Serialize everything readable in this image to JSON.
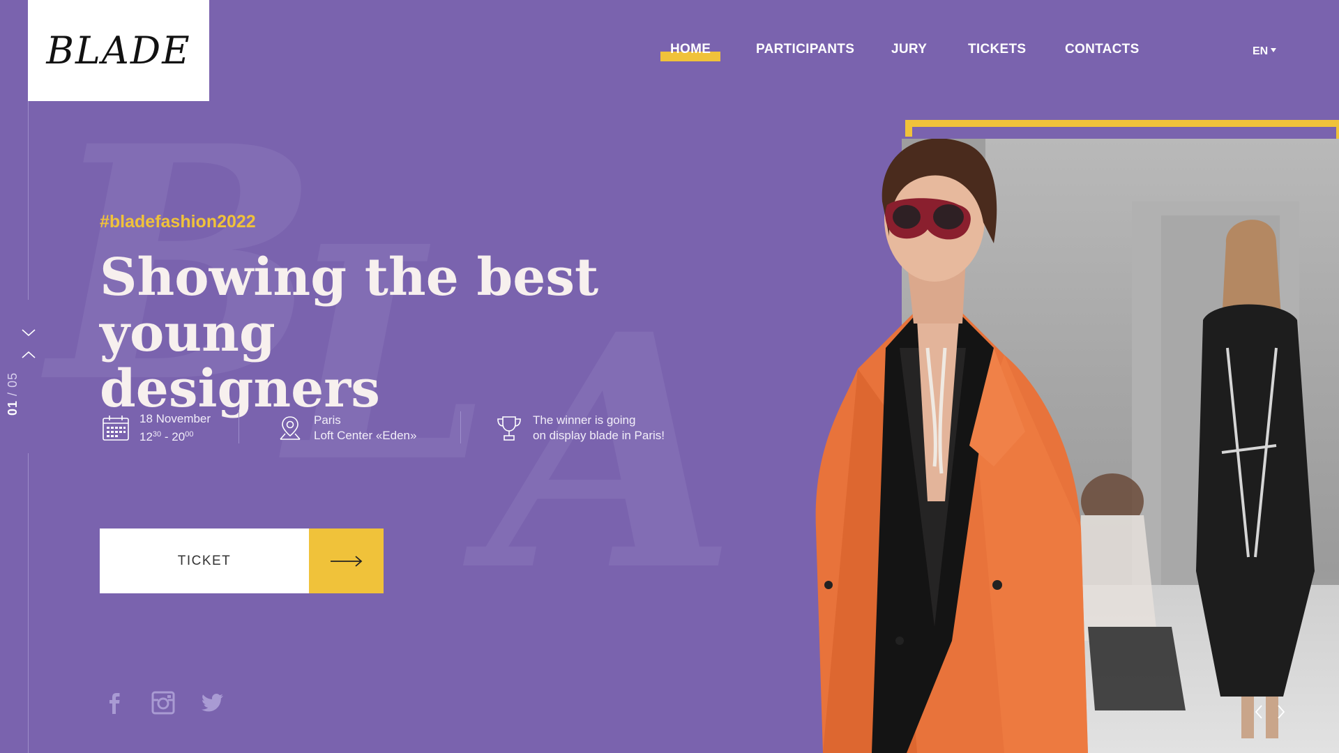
{
  "brand": {
    "logo_text": "BLADE"
  },
  "nav": {
    "items": [
      {
        "label": "HOME",
        "active": true
      },
      {
        "label": "PARTICIPANTS",
        "active": false
      },
      {
        "label": "JURY",
        "active": false
      },
      {
        "label": "TICKETS",
        "active": false
      },
      {
        "label": "CONTACTS",
        "active": false
      }
    ],
    "language": "EN"
  },
  "slider": {
    "current": "01",
    "separator": "/",
    "total": "05"
  },
  "hero": {
    "hashtag": "#bladefashion2022",
    "headline_line1": "Showing the best young",
    "headline_line2": "designers"
  },
  "info": {
    "date": {
      "day": "18 November",
      "start_hour": "12",
      "start_min": "30",
      "dash": " - ",
      "end_hour": "20",
      "end_min": "00"
    },
    "location": {
      "city": "Paris",
      "venue": "Loft Center «Eden»"
    },
    "prize": {
      "line1": "The winner is going",
      "line2": "on display blade in Paris!"
    }
  },
  "cta": {
    "label": "TICKET"
  },
  "social": [
    "facebook-icon",
    "instagram-icon",
    "twitter-icon"
  ],
  "colors": {
    "background": "#7a63ae",
    "accent": "#f0c23a",
    "headline": "#f7f0ee"
  }
}
